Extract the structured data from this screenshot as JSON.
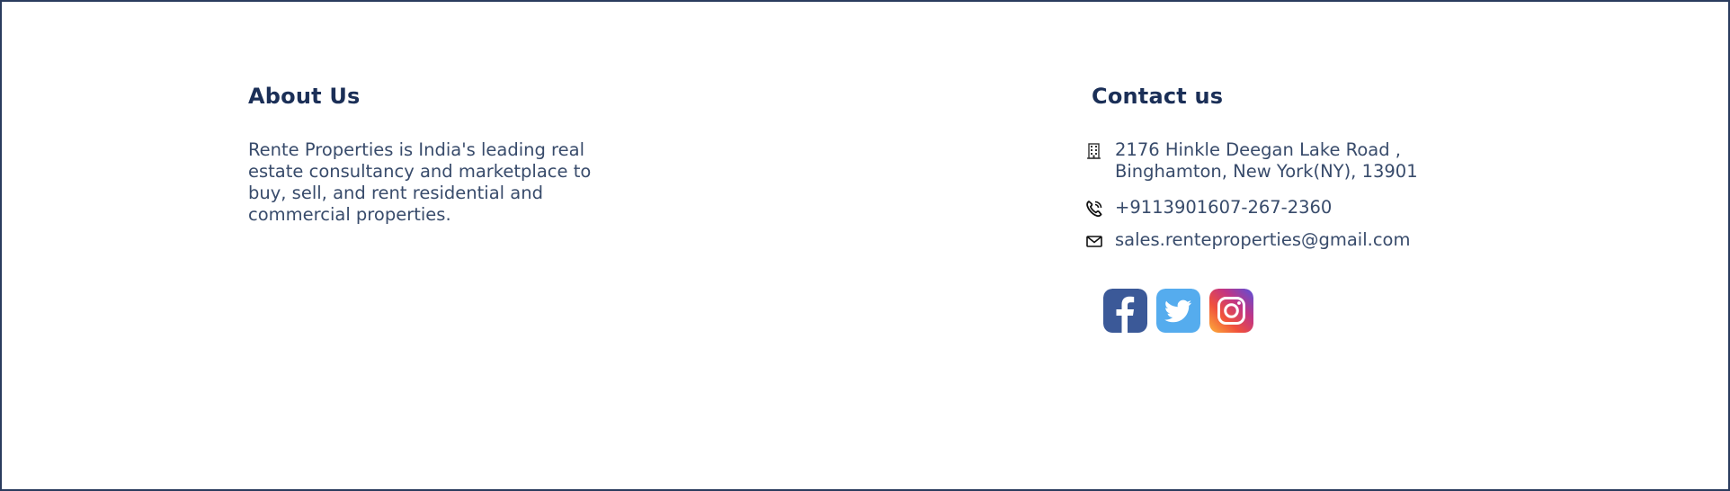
{
  "about": {
    "title": "About Us",
    "text": "Rente Properties is India's leading real estate consultancy and marketplace to buy, sell, and rent residential and commercial properties."
  },
  "contact": {
    "title": "Contact us",
    "address_line1": "2176 Hinkle Deegan Lake Road ,",
    "address_line2": "Binghamton, New York(NY), 13901",
    "phone": "+9113901607-267-2360",
    "email": "sales.renteproperties@gmail.com",
    "icons": {
      "address": "building-icon",
      "phone": "phone-icon",
      "email": "mail-icon"
    }
  },
  "social": {
    "items": [
      {
        "name": "facebook-icon",
        "color": "#3b5998"
      },
      {
        "name": "twitter-icon",
        "color": "#55acee"
      },
      {
        "name": "instagram-icon",
        "color": "#c13584"
      }
    ]
  },
  "colors": {
    "heading": "#1b2f57",
    "text": "#384b6b",
    "border": "#2a3c5e"
  }
}
